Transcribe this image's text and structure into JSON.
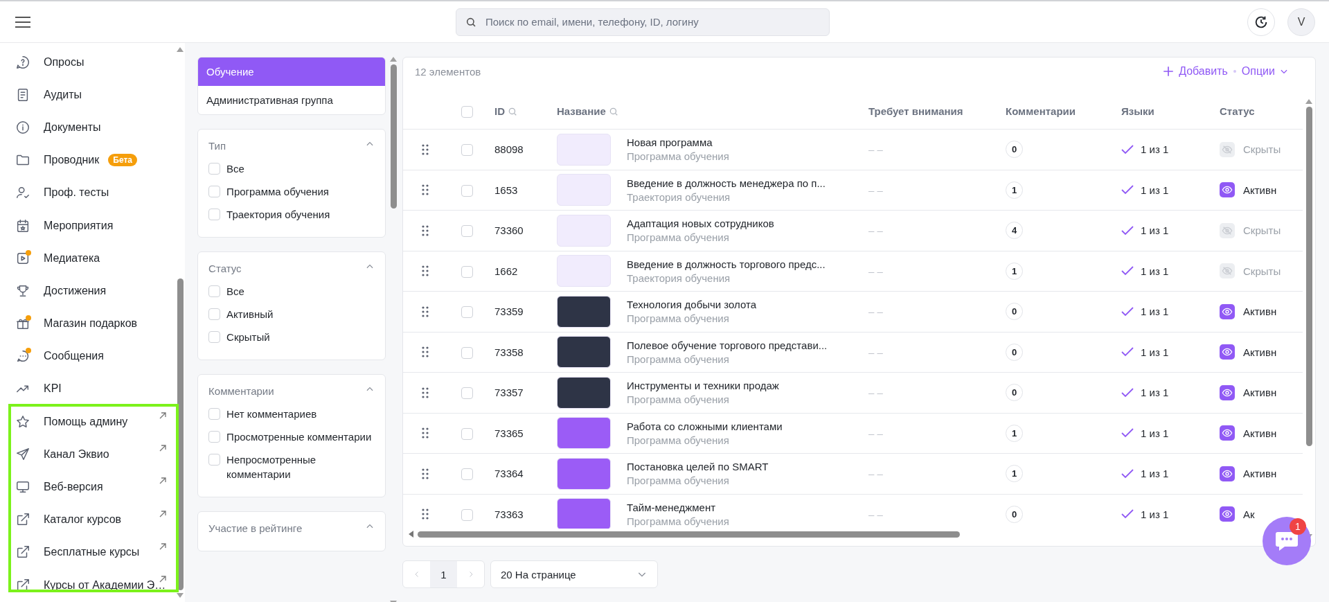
{
  "search": {
    "placeholder": "Поиск по email, имени, телефону, ID, логину"
  },
  "user": {
    "initial": "V"
  },
  "sidebar": {
    "items": [
      {
        "label": "Опросы",
        "notification_dot": false,
        "external": false
      },
      {
        "label": "Аудиты",
        "notification_dot": false,
        "external": false
      },
      {
        "label": "Документы",
        "notification_dot": false,
        "external": false
      },
      {
        "label": "Проводник",
        "badge": "Бета",
        "notification_dot": false,
        "external": false
      },
      {
        "label": "Проф. тесты",
        "notification_dot": false,
        "external": false
      },
      {
        "label": "Мероприятия",
        "notification_dot": false,
        "external": false
      },
      {
        "label": "Медиатека",
        "notification_dot": true,
        "external": false
      },
      {
        "label": "Достижения",
        "notification_dot": false,
        "external": false
      },
      {
        "label": "Магазин подарков",
        "notification_dot": true,
        "external": false
      },
      {
        "label": "Сообщения",
        "notification_dot": true,
        "external": false
      },
      {
        "label": "KPI",
        "notification_dot": false,
        "external": false
      },
      {
        "label": "Помощь админу",
        "notification_dot": false,
        "external": true
      },
      {
        "label": "Канал Эквио",
        "notification_dot": false,
        "external": true
      },
      {
        "label": "Веб-версия",
        "notification_dot": false,
        "external": true
      },
      {
        "label": "Каталог курсов",
        "notification_dot": false,
        "external": true
      },
      {
        "label": "Бесплатные курсы",
        "notification_dot": false,
        "external": true
      },
      {
        "label": "Курсы от Академии Э…",
        "notification_dot": false,
        "external": true
      }
    ]
  },
  "groups": [
    {
      "label": "Обучение",
      "selected": true
    },
    {
      "label": "Административная группа",
      "selected": false
    }
  ],
  "filters": [
    {
      "title": "Тип",
      "expanded": true,
      "options": [
        {
          "label": "Все",
          "checked": false
        },
        {
          "label": "Программа обучения",
          "checked": false
        },
        {
          "label": "Траектория обучения",
          "checked": false
        }
      ]
    },
    {
      "title": "Статус",
      "expanded": true,
      "options": [
        {
          "label": "Все",
          "checked": false
        },
        {
          "label": "Активный",
          "checked": false
        },
        {
          "label": "Скрытый",
          "checked": false
        }
      ]
    },
    {
      "title": "Комментарии",
      "expanded": true,
      "options": [
        {
          "label": "Нет комментариев",
          "checked": false
        },
        {
          "label": "Просмотренные комментарии",
          "checked": false
        },
        {
          "label": "Непросмотренные комментарии",
          "checked": false
        }
      ]
    },
    {
      "title": "Участие в рейтинге",
      "expanded": true
    }
  ],
  "table": {
    "all_checked": false,
    "count": "12 элементов",
    "add": "Добавить",
    "options": "Опции",
    "columns": [
      "ID",
      "Название",
      "Требует внимания",
      "Комментарии",
      "Языки",
      "Статус"
    ],
    "rows": [
      {
        "id": "88098",
        "title": "Новая программа",
        "type": "Программа обучения",
        "kind": "light",
        "attention": "– –",
        "comments": "0",
        "languages": "1 из 1",
        "status": "Скрыты",
        "active": false,
        "checked": false
      },
      {
        "id": "1653",
        "title": "Введение в должность менеджера по п...",
        "type": "Траектория обучения",
        "kind": "light",
        "attention": "– –",
        "comments": "1",
        "languages": "1 из 1",
        "status": "Активн",
        "active": true,
        "checked": false
      },
      {
        "id": "73360",
        "title": "Адаптация новых сотрудников",
        "type": "Программа обучения",
        "kind": "light",
        "attention": "– –",
        "comments": "4",
        "languages": "1 из 1",
        "status": "Скрыты",
        "active": false,
        "checked": false
      },
      {
        "id": "1662",
        "title": "Введение в должность торгового предс...",
        "type": "Траектория обучения",
        "kind": "light",
        "attention": "– –",
        "comments": "1",
        "languages": "1 из 1",
        "status": "Скрыты",
        "active": false,
        "checked": false
      },
      {
        "id": "73359",
        "title": "Технология добычи золота",
        "type": "Программа обучения",
        "kind": "dark",
        "attention": "– –",
        "comments": "0",
        "languages": "1 из 1",
        "status": "Активн",
        "active": true,
        "checked": false
      },
      {
        "id": "73358",
        "title": "Полевое обучение торгового представи...",
        "type": "Программа обучения",
        "kind": "dark",
        "attention": "– –",
        "comments": "0",
        "languages": "1 из 1",
        "status": "Активн",
        "active": true,
        "checked": false
      },
      {
        "id": "73357",
        "title": "Инструменты и техники продаж",
        "type": "Программа обучения",
        "kind": "dark",
        "attention": "– –",
        "comments": "0",
        "languages": "1 из 1",
        "status": "Активн",
        "active": true,
        "checked": false
      },
      {
        "id": "73365",
        "title": "Работа со сложными клиентами",
        "type": "Программа обучения",
        "kind": "purple",
        "attention": "– –",
        "comments": "1",
        "languages": "1 из 1",
        "status": "Активн",
        "active": true,
        "checked": false
      },
      {
        "id": "73364",
        "title": "Постановка целей по SMART",
        "type": "Программа обучения",
        "kind": "purple",
        "attention": "– –",
        "comments": "1",
        "languages": "1 из 1",
        "status": "Активн",
        "active": true,
        "checked": false
      },
      {
        "id": "73363",
        "title": "Тайм-менеджмент",
        "type": "Программа обучения",
        "kind": "purple",
        "attention": "– –",
        "comments": "0",
        "languages": "1 из 1",
        "status": "Ак",
        "active": true,
        "checked": false
      }
    ]
  },
  "pagination": {
    "page": "1",
    "page_size": "20 На странице"
  },
  "chat": {
    "badge": "1"
  }
}
